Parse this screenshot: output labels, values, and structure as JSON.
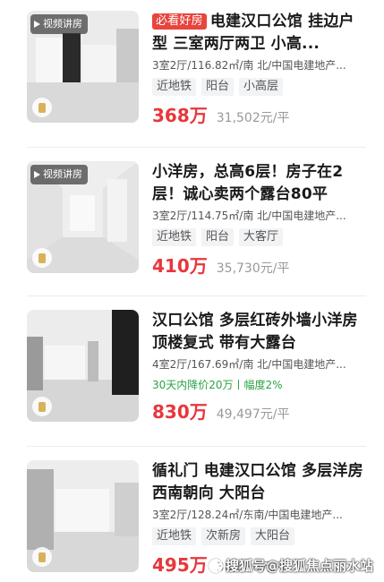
{
  "listings": [
    {
      "badge": "必看好房",
      "video_label": "视频讲房",
      "title": "电建汉口公馆 挂边户型 三室两厅两卫 小高...",
      "meta": "3室2厅/116.82㎡/南 北/中国电建地产...",
      "tags": [
        "近地铁",
        "阳台",
        "小高层"
      ],
      "price": "368万",
      "unit_price": "31,502元/平"
    },
    {
      "video_label": "视频讲房",
      "title": "小洋房，总高6层！房子在2层！诚心卖两个露台80平",
      "meta": "3室2厅/114.75㎡/南 北/中国电建地产...",
      "tags": [
        "近地铁",
        "阳台",
        "大客厅"
      ],
      "price": "410万",
      "unit_price": "35,730元/平"
    },
    {
      "title": "汉口公馆 多层红砖外墙小洋房 顶楼复式 带有大露台",
      "meta": "4室2厅/167.69㎡/南 北/中国电建地产...",
      "price_drop": "30天内降价20万丨幅度2%",
      "price": "830万",
      "unit_price": "49,497元/平"
    },
    {
      "title": "循礼门 电建汉口公馆 多层洋房 西南朝向 大阳台",
      "meta": "3室2厅/128.24㎡/东南/中国电建地产...",
      "tags": [
        "近地铁",
        "次新房",
        "大阳台"
      ],
      "price": "495万",
      "unit_price": "38,600元/平"
    }
  ],
  "watermark": "搜狐号@搜狐焦点丽水站"
}
